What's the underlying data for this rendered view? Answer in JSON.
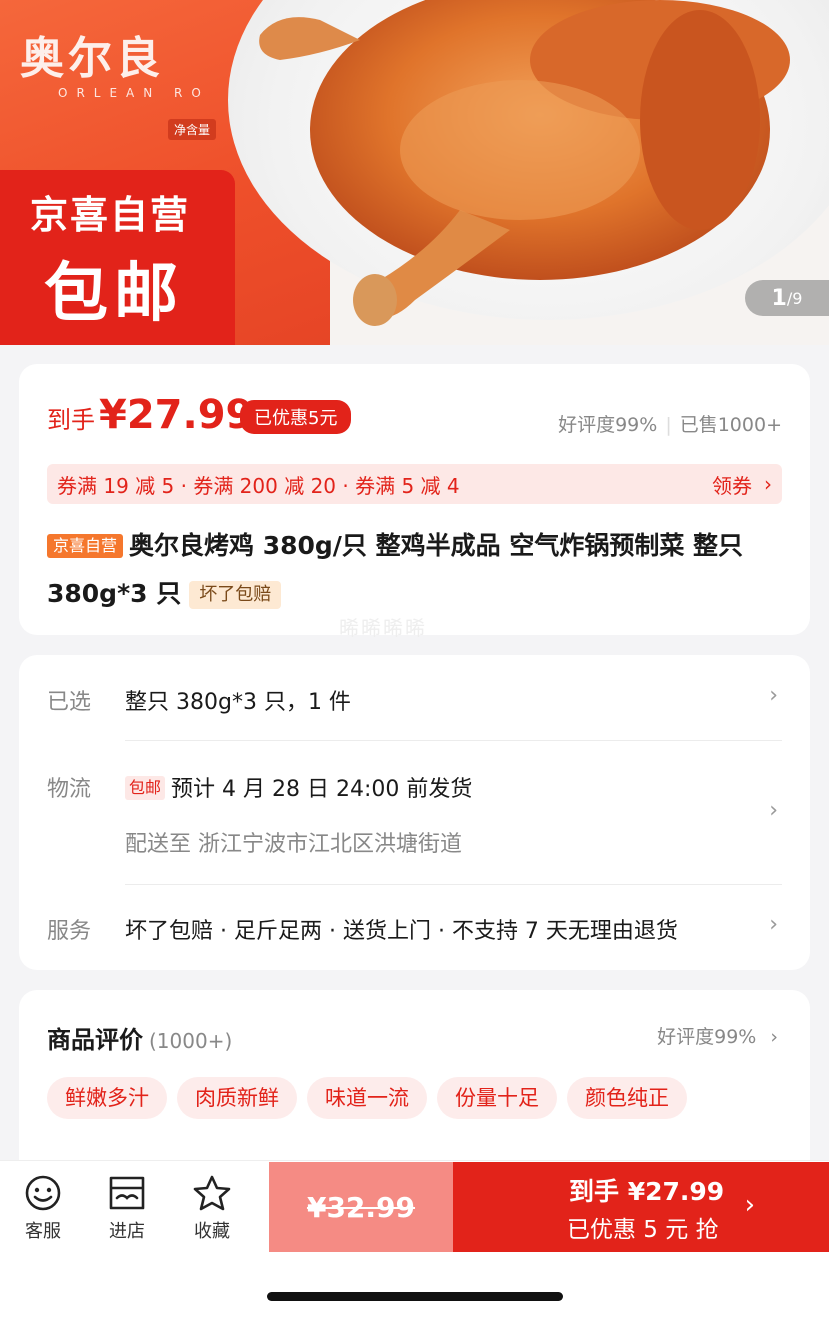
{
  "hero": {
    "brand_title": "奥尔良",
    "brand_subtitle": "ORLEAN RO",
    "brand_net": "净含量",
    "badge_line1": "京喜自营",
    "badge_line2": "包邮",
    "page_current": "1",
    "page_total": "/9"
  },
  "price": {
    "prefix": "到手",
    "value": "¥27.99",
    "discount_chip": "已优惠5元",
    "rating": "好评度99%",
    "sold": "已售1000+"
  },
  "coupons": {
    "text": "券满 19 减 5 · 券满 200 减 20 · 券满 5 减 4",
    "action": "领券"
  },
  "product": {
    "tag": "京喜自营",
    "title": "奥尔良烤鸡 380g/只 整鸡半成品 空气炸锅预制菜 整只 380g*3 只",
    "guarantee_tag": "坏了包赔",
    "watermark": "晞晞晞晞"
  },
  "info": {
    "selected_label": "已选",
    "selected_value": "整只 380g*3 只，1 件",
    "logistics_label": "物流",
    "logistics_tag": "包邮",
    "logistics_value": "预计 4 月 28 日 24:00 前发货",
    "delivery_value": "配送至 浙江宁波市江北区洪塘街道",
    "service_label": "服务",
    "service_value": "坏了包赔 · 足斤足两 · 送货上门 · 不支持 7 天无理由退货"
  },
  "reviews": {
    "title": "商品评价",
    "count": "(1000+)",
    "rating": "好评度99%",
    "tags": [
      "鲜嫩多汁",
      "肉质新鲜",
      "味道一流",
      "份量十足",
      "颜色纯正"
    ]
  },
  "bottom": {
    "service_label": "客服",
    "store_label": "进店",
    "fav_label": "收藏",
    "original_price": "¥32.99",
    "buy_line1": "到手 ¥27.99",
    "buy_line2": "已优惠 5 元 抢"
  },
  "colors": {
    "accent": "#e2231a",
    "orange": "#f5772d"
  }
}
